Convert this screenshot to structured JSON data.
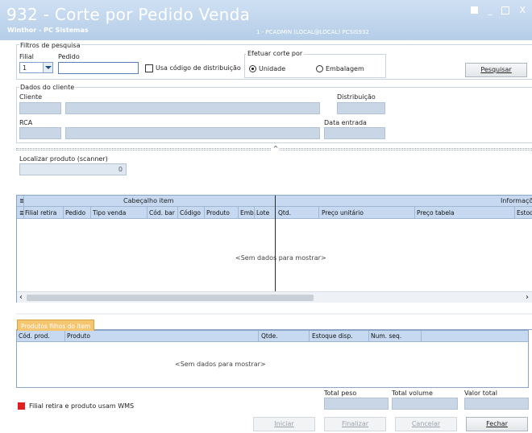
{
  "window": {
    "title": "932 - Corte por Pedido Venda",
    "subtitle": "Winthor - PC Sistemas",
    "user_info": "1 - PCADMIN (LOCAL@LOCAL)  PCSIS932",
    "min_glyph": "_",
    "close_glyph": "X"
  },
  "filters": {
    "group_label": "Filtros de pesquisa",
    "filial_label": "Filial",
    "filial_value": "1",
    "pedido_label": "Pedido",
    "pedido_value": "",
    "dist_checkbox_label": "Usa código de distribuição",
    "corte_group_label": "Efetuar corte por",
    "radio_unidade": "Unidade",
    "radio_embalagem": "Embalagem",
    "search_button": "Pesquisar"
  },
  "client": {
    "group_label": "Dados do cliente",
    "cliente_label": "Cliente",
    "distribuicao_label": "Distribuição",
    "rca_label": "RCA",
    "data_entrada_label": "Data entrada"
  },
  "scanner": {
    "label": "Localizar produto (scanner)",
    "value": "0"
  },
  "items_grid": {
    "band_left": "Cabeçalho item",
    "band_right": "Informaçõ",
    "columns": [
      "Filial retira",
      "Pedido",
      "Tipo venda",
      "Cód. bar",
      "Código",
      "Produto",
      "Emb.",
      "Lote",
      "Qtd.",
      "Preço unitário",
      "Preço tabela",
      "Estoq"
    ],
    "empty_message": "<Sem dados para mostrar>",
    "scroll_left": "‹",
    "scroll_right": "›"
  },
  "children_grid": {
    "tab_label": "Produtos filhos do item",
    "columns": [
      "Cód. prod.",
      "Produto",
      "Qtde.",
      "Estoque disp.",
      "Num. seq."
    ],
    "empty_message": "<Sem dados para mostrar>"
  },
  "legend": {
    "color": "#e02020",
    "text": "Filial retira e produto usam WMS"
  },
  "totals": {
    "peso_label": "Total peso",
    "volume_label": "Total volume",
    "valor_label": "Valor total"
  },
  "footer_buttons": {
    "iniciar": "Iniciar",
    "finalizar": "Finalizar",
    "cancelar": "Cancelar",
    "fechar": "Fechar"
  }
}
